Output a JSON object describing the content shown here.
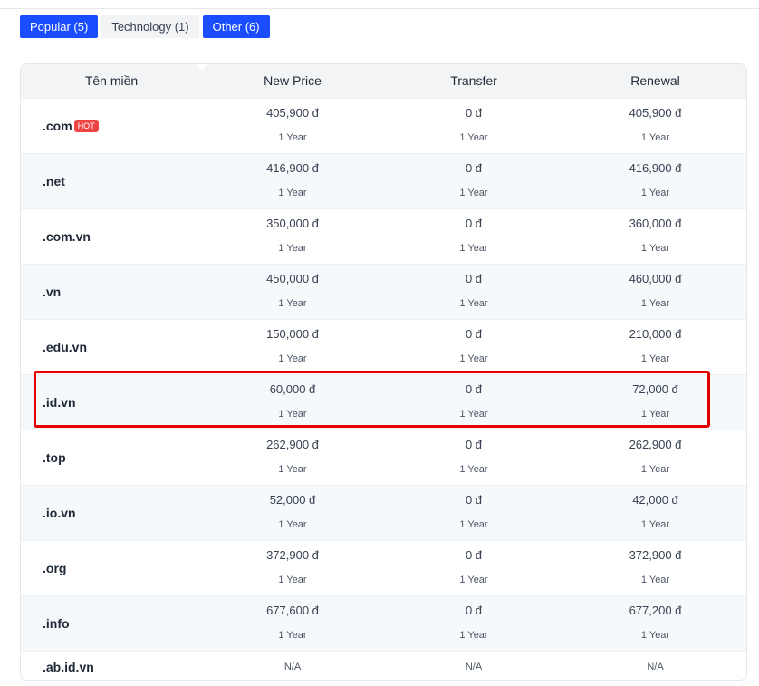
{
  "tabs": [
    {
      "label": "Popular (5)"
    },
    {
      "label": "Technology (1)"
    },
    {
      "label": "Other (6)"
    }
  ],
  "table": {
    "headers": [
      "Tên miền",
      "New Price",
      "Transfer",
      "Renewal"
    ],
    "hot_badge": "HOT",
    "rows": [
      {
        "domain": ".com",
        "new_price": "405,900 đ",
        "new_period": "1 Year",
        "transfer": "0 đ",
        "transfer_period": "1 Year",
        "renewal": "405,900 đ",
        "renewal_period": "1 Year"
      },
      {
        "domain": ".net",
        "new_price": "416,900 đ",
        "new_period": "1 Year",
        "transfer": "0 đ",
        "transfer_period": "1 Year",
        "renewal": "416,900 đ",
        "renewal_period": "1 Year"
      },
      {
        "domain": ".com.vn",
        "new_price": "350,000 đ",
        "new_period": "1 Year",
        "transfer": "0 đ",
        "transfer_period": "1 Year",
        "renewal": "360,000 đ",
        "renewal_period": "1 Year"
      },
      {
        "domain": ".vn",
        "new_price": "450,000 đ",
        "new_period": "1 Year",
        "transfer": "0 đ",
        "transfer_period": "1 Year",
        "renewal": "460,000 đ",
        "renewal_period": "1 Year"
      },
      {
        "domain": ".edu.vn",
        "new_price": "150,000 đ",
        "new_period": "1 Year",
        "transfer": "0 đ",
        "transfer_period": "1 Year",
        "renewal": "210,000 đ",
        "renewal_period": "1 Year"
      },
      {
        "domain": ".id.vn",
        "new_price": "60,000 đ",
        "new_period": "1 Year",
        "transfer": "0 đ",
        "transfer_period": "1 Year",
        "renewal": "72,000 đ",
        "renewal_period": "1 Year"
      },
      {
        "domain": ".top",
        "new_price": "262,900 đ",
        "new_period": "1 Year",
        "transfer": "0 đ",
        "transfer_period": "1 Year",
        "renewal": "262,900 đ",
        "renewal_period": "1 Year"
      },
      {
        "domain": ".io.vn",
        "new_price": "52,000 đ",
        "new_period": "1 Year",
        "transfer": "0 đ",
        "transfer_period": "1 Year",
        "renewal": "42,000 đ",
        "renewal_period": "1 Year"
      },
      {
        "domain": ".org",
        "new_price": "372,900 đ",
        "new_period": "1 Year",
        "transfer": "0 đ",
        "transfer_period": "1 Year",
        "renewal": "372,900 đ",
        "renewal_period": "1 Year"
      },
      {
        "domain": ".info",
        "new_price": "677,600 đ",
        "new_period": "1 Year",
        "transfer": "0 đ",
        "transfer_period": "1 Year",
        "renewal": "677,200 đ",
        "renewal_period": "1 Year"
      },
      {
        "domain": ".ab.id.vn",
        "new_price": "N/A",
        "transfer": "N/A",
        "renewal": "N/A"
      }
    ]
  },
  "colors": {
    "tab_active": "#1a4dff",
    "hot_badge": "#ef4444",
    "highlight_border": "#e50000",
    "alt_row": "#f6f9fc"
  }
}
